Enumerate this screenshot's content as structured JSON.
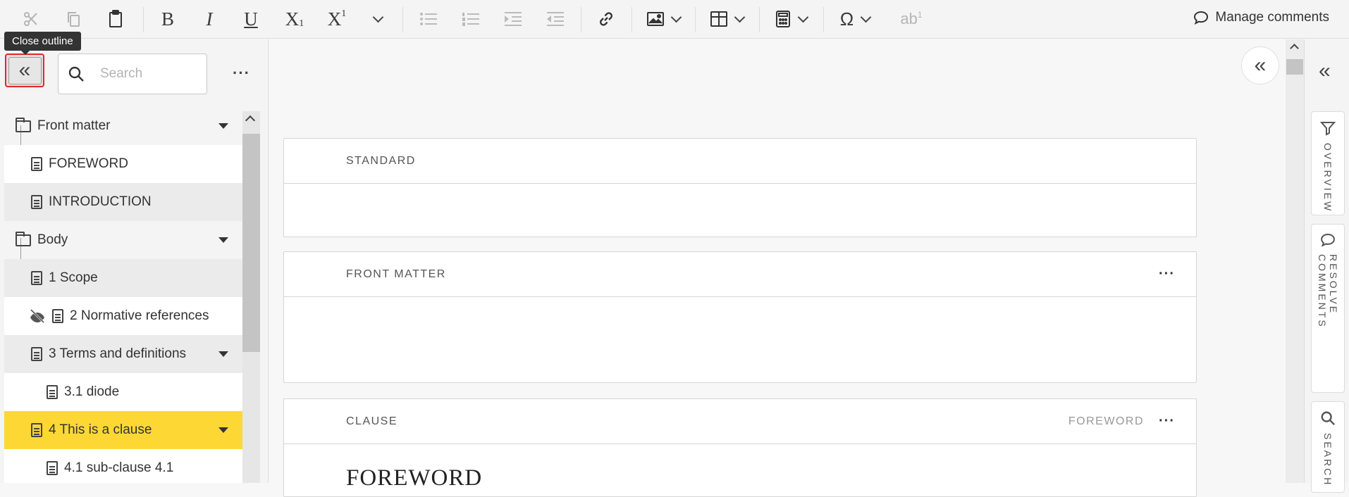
{
  "toolbar": {
    "cut_icon": "scissors-icon",
    "copy_icon": "copy-icon",
    "paste_icon": "clipboard-icon",
    "bold": "B",
    "italic": "I",
    "underline": "U",
    "subscript": "X",
    "subscript_sub": "1",
    "superscript": "X",
    "superscript_sup": "1",
    "special_chars": "Ω",
    "footnote": "ab",
    "footnote_sup": "1",
    "manage_comments": "Manage comments"
  },
  "tooltip": {
    "close_outline": "Close outline"
  },
  "outline": {
    "collapse_glyph": "«",
    "search_placeholder": "Search",
    "more": "···",
    "items": [
      {
        "label": "Front matter"
      },
      {
        "label": "FOREWORD"
      },
      {
        "label": "INTRODUCTION"
      },
      {
        "label": "Body"
      },
      {
        "label": "1 Scope"
      },
      {
        "label": "2 Normative references"
      },
      {
        "label": "3 Terms and definitions"
      },
      {
        "label": "3.1 diode"
      },
      {
        "label": "4 This is a clause"
      },
      {
        "label": "4.1 sub-clause 4.1"
      }
    ]
  },
  "main": {
    "cards": [
      {
        "header": "STANDARD"
      },
      {
        "header": "FRONT MATTER",
        "more": "···"
      },
      {
        "header": "CLAUSE",
        "tag": "FOREWORD",
        "more": "···",
        "title": "FOREWORD"
      }
    ],
    "expand_glyph": "«"
  },
  "side": {
    "collapse_glyph": "«",
    "tabs": [
      {
        "label": "OVERVIEW",
        "icon": "filter-icon"
      },
      {
        "label": "RESOLVE COMMENTS",
        "icon": "comment-icon"
      },
      {
        "label": "SEARCH",
        "icon": "search-icon"
      }
    ]
  },
  "colors": {
    "selected_row": "#fdd835",
    "focus_outline": "#e0282e"
  }
}
